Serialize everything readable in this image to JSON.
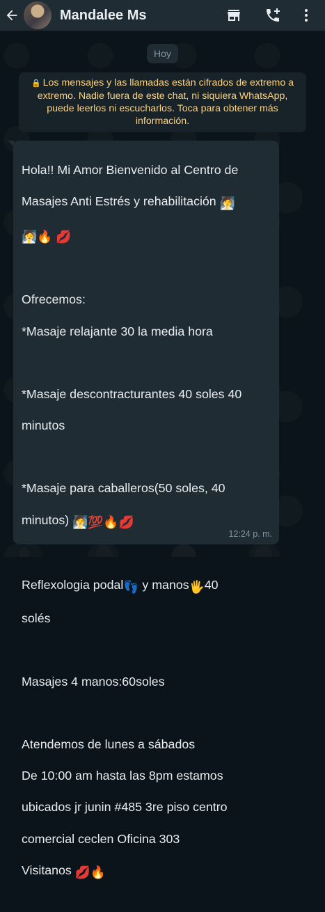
{
  "header": {
    "contact_name": "Mandalee Ms",
    "icons": [
      "back-arrow-icon",
      "store-icon",
      "add-call-icon",
      "more-vert-icon"
    ]
  },
  "date_chip": "Hoy",
  "encryption_notice": "Los mensajes y las llamadas están cifrados de extremo a extremo. Nadie fuera de este chat, ni siquiera WhatsApp, puede leerlos ni escucharlos. Toca para obtener más información.",
  "message": {
    "lines": [
      "Hola!! Mi Amor Bienvenido al Centro de",
      "Masajes Anti Estrés y rehabilitación",
      "",
      "Ofrecemos:",
      "*Masaje relajante 30 la media hora",
      "*Masaje descontracturantes 40 soles 40",
      "minutos",
      "*Masaje para caballeros(50 soles, 40",
      "minutos)",
      "Reflexologia podal",
      "y manos",
      "40",
      "solés",
      "Masajes 4 manos:60soles",
      "Atendemos de lunes a sábados",
      "De 10:00 am hasta las 8pm estamos",
      "ubicados jr junin #485 3re piso centro",
      "comercial ceclen Oficina 303",
      "Visitanos"
    ],
    "emojis": {
      "spa_person": "🧖",
      "fire": "🔥",
      "kiss": "💋",
      "hundred": "💯",
      "footprints": "👣",
      "hand": "🖐"
    },
    "time": "12:24 p. m."
  },
  "colors": {
    "header_bg": "#1f2c34",
    "chat_bg": "#0b141a",
    "bubble_bg": "#202c33",
    "notice_text": "#ffd279",
    "text": "#e9edef",
    "meta": "#8696a0"
  }
}
